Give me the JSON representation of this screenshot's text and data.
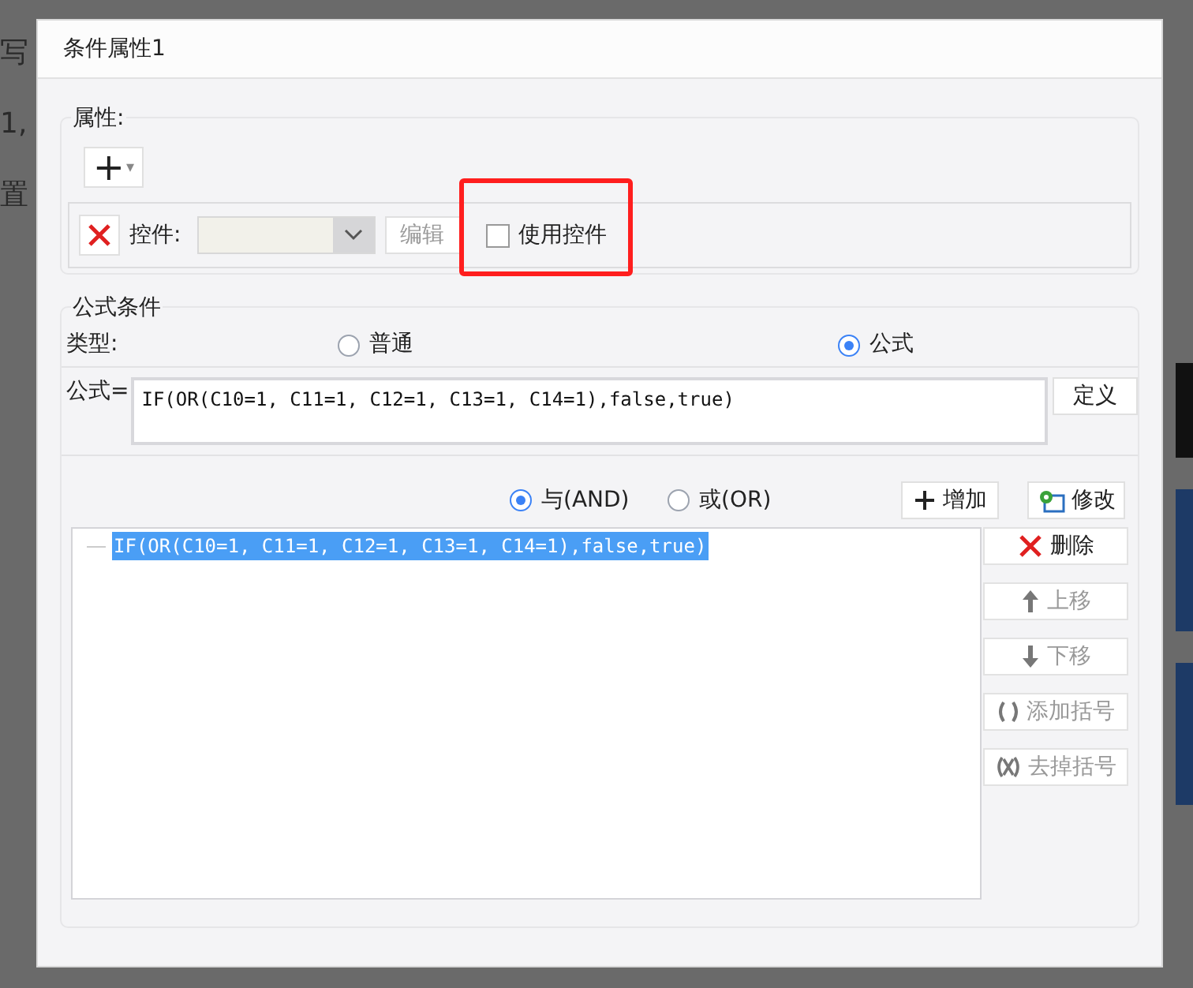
{
  "background": {
    "fragments": [
      "写",
      "1,",
      "置"
    ]
  },
  "dialog": {
    "title": "条件属性1",
    "properties": {
      "legend": "属性:",
      "add_button": {
        "label": "+",
        "caret": "▾"
      },
      "control_row": {
        "label": "控件:",
        "combo_disabled": true,
        "edit_button": {
          "label": "编辑",
          "disabled": true
        },
        "use_control": {
          "label": "使用控件",
          "checked": false,
          "highlighted": true
        }
      }
    },
    "formula_condition": {
      "legend": "公式条件",
      "type_label": "类型:",
      "types": [
        {
          "label": "普通",
          "selected": false
        },
        {
          "label": "公式",
          "selected": true
        }
      ],
      "formula_label": "公式=",
      "formula": "IF(OR(C10=1, C11=1, C12=1, C13=1, C14=1),false,true)",
      "define_button": "定义",
      "joins": [
        {
          "label": "与(AND)",
          "selected": true
        },
        {
          "label": "或(OR)",
          "selected": false
        }
      ],
      "add_button": "增加",
      "modify_button": "修改",
      "conditions": [
        {
          "text": "IF(OR(C10=1, C11=1, C12=1, C13=1, C14=1),false,true)",
          "selected": true
        }
      ],
      "side_buttons": [
        {
          "kind": "delete",
          "label": "删除",
          "disabled": false
        },
        {
          "kind": "up",
          "label": "上移",
          "disabled": true
        },
        {
          "kind": "down",
          "label": "下移",
          "disabled": true
        },
        {
          "kind": "addparen",
          "label": "添加括号",
          "disabled": true
        },
        {
          "kind": "removeparen",
          "label": "去掉括号",
          "disabled": true
        }
      ]
    }
  }
}
